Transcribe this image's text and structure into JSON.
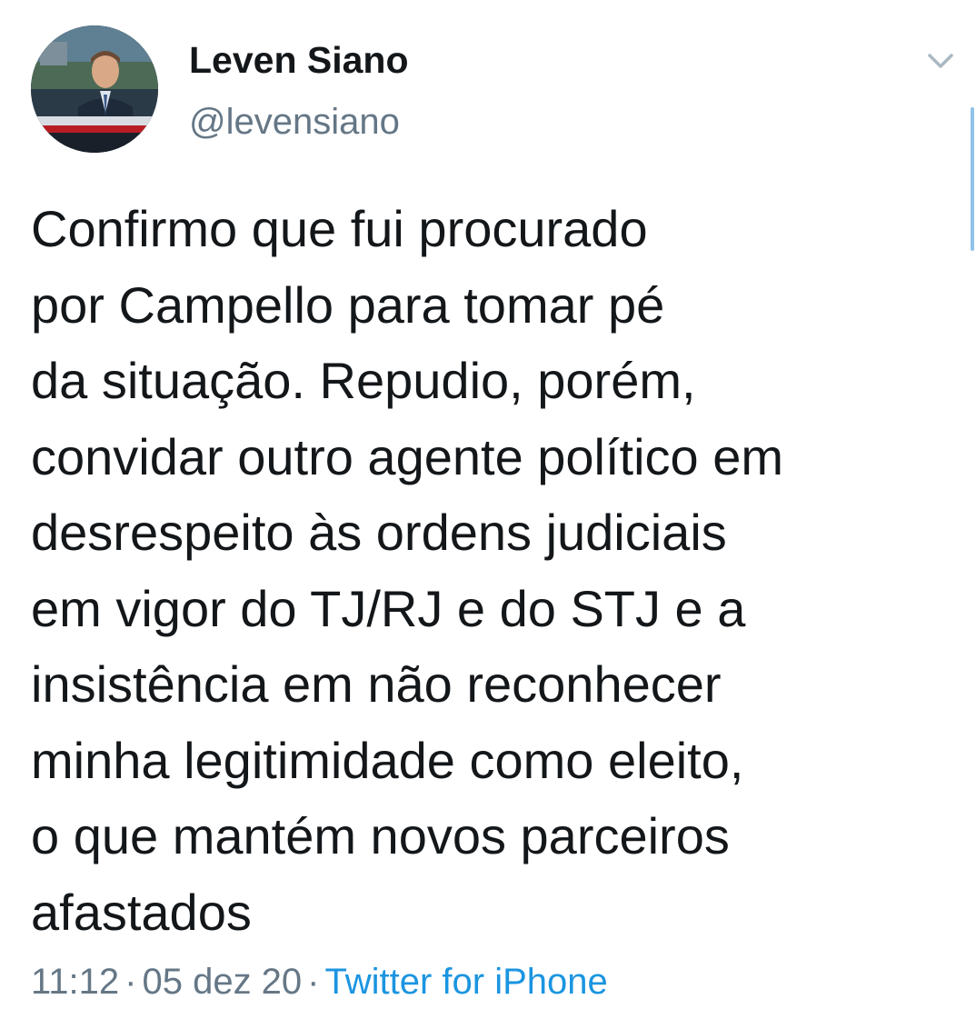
{
  "author": {
    "display_name": "Leven Siano",
    "handle": "@levensiano",
    "avatar_icon": "profile-photo-news-broadcast"
  },
  "tweet": {
    "lines": [
      "Confirmo que fui procurado",
      "por Campello para tomar pé",
      "da situação. Repudio, porém,",
      "convidar outro agente político em",
      "desrespeito às ordens judiciais",
      "em vigor do TJ/RJ e do STJ e a",
      "insistência em não reconhecer",
      "minha legitimidade como eleito,",
      "o que mantém novos parceiros",
      "afastados"
    ],
    "time": "11:12",
    "separator": "·",
    "date": "05 dez 20",
    "source": "Twitter for iPhone"
  },
  "icons": {
    "menu": "chevron-down-icon"
  },
  "colors": {
    "text_primary": "#14171a",
    "text_secondary": "#657786",
    "link": "#1b95e0",
    "scroll_indicator": "#8fc3ea",
    "background": "#ffffff"
  }
}
